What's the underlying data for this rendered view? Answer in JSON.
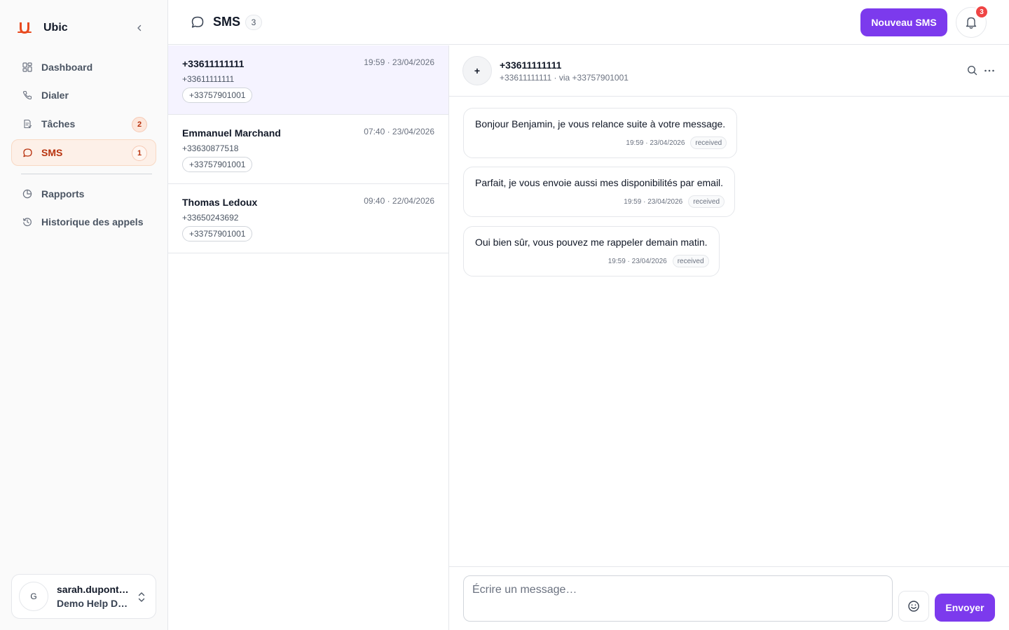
{
  "brand": {
    "name": "Ubic",
    "accent": "#e84a1f"
  },
  "sidebar": {
    "items": [
      {
        "label": "Dashboard",
        "icon": "grid-icon"
      },
      {
        "label": "Dialer",
        "icon": "phone-icon"
      },
      {
        "label": "Tâches",
        "icon": "tasks-icon",
        "badge": "2"
      },
      {
        "label": "SMS",
        "icon": "message-icon",
        "badge": "1",
        "active": true
      },
      {
        "label": "Rapports",
        "icon": "pie-chart-icon"
      },
      {
        "label": "Historique des appels",
        "icon": "history-icon"
      }
    ],
    "user": {
      "initial": "G",
      "email": "sarah.dupont@demo.com",
      "org": "Demo Help Desk"
    }
  },
  "header": {
    "title": "SMS",
    "count": "3",
    "new_button": "Nouveau SMS",
    "notifications": "3",
    "primary_color": "#7c3aed"
  },
  "conversations": [
    {
      "name": "+33611111111",
      "time": "19:59 · 23/04/2026",
      "phone": "+33611111111",
      "via": "+33757901001",
      "selected": true
    },
    {
      "name": "Emmanuel Marchand",
      "time": "07:40 · 23/04/2026",
      "phone": "+33630877518",
      "via": "+33757901001"
    },
    {
      "name": "Thomas Ledoux",
      "time": "09:40 · 22/04/2026",
      "phone": "+33650243692",
      "via": "+33757901001"
    }
  ],
  "chat": {
    "avatar": "+",
    "name": "+33611111111",
    "subtitle": "+33611111111 · via +33757901001",
    "messages": [
      {
        "text": "Bonjour Benjamin, je vous relance suite à votre message.",
        "time": "19:59 · 23/04/2026",
        "status": "received"
      },
      {
        "text": "Parfait, je vous envoie aussi mes disponibilités par email.",
        "time": "19:59 · 23/04/2026",
        "status": "received"
      },
      {
        "text": "Oui bien sûr, vous pouvez me rappeler demain matin.",
        "time": "19:59 · 23/04/2026",
        "status": "received"
      }
    ],
    "composer": {
      "placeholder": "Écrire un message…",
      "send_label": "Envoyer"
    }
  }
}
